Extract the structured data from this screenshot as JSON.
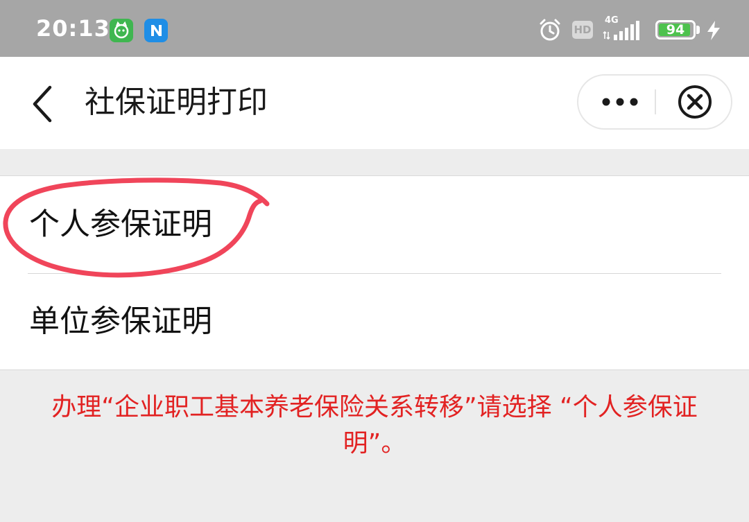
{
  "status_bar": {
    "time": "20:13",
    "hd_label": "HD",
    "network_label": "4G",
    "battery_level": "94",
    "battery_percent": 94,
    "icons": [
      "wechat-cat-app-icon",
      "n-app-icon",
      "alarm-icon",
      "signal-icon",
      "battery-icon",
      "charging-icon"
    ]
  },
  "nav": {
    "title": "社保证明打印",
    "back_icon": "chevron-left-icon",
    "more_icon": "more-dots-icon",
    "close_icon": "close-circle-icon"
  },
  "list": {
    "items": [
      {
        "label": "个人参保证明"
      },
      {
        "label": "单位参保证明"
      }
    ]
  },
  "notice": {
    "text": "办理“企业职工基本养老保险关系转移”请选择 “个人参保证明”。"
  },
  "colors": {
    "status_bar_bg": "#a6a6a6",
    "notice_text": "#e22222",
    "annotation_circle": "#f0455a",
    "battery_fill": "#4dc24d"
  }
}
